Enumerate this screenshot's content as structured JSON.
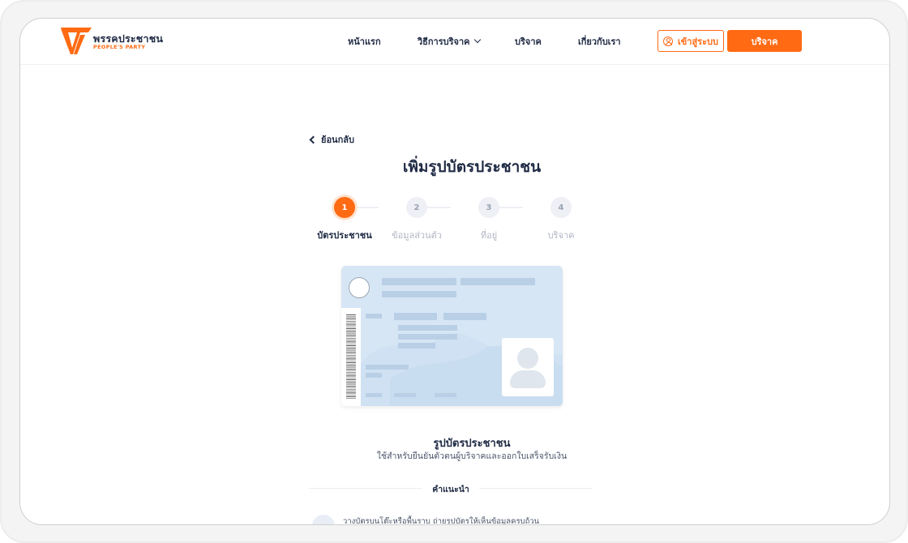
{
  "header": {
    "logo_th": "พรรคประชาชน",
    "logo_en": "PEOPLE'S PARTY",
    "nav": [
      {
        "label": "หน้าแรก"
      },
      {
        "label": "วิธีการบริจาค"
      },
      {
        "label": "บริจาค"
      },
      {
        "label": "เกี่ยวกับเรา"
      }
    ],
    "login_label": "เข้าสู่ระบบ",
    "donate_label": "บริจาค"
  },
  "content": {
    "back_label": "ย้อนกลับ",
    "title": "เพิ่มรูปบัตรประชาชน",
    "steps": [
      {
        "number": "1",
        "label": "บัตรประชาชน",
        "active": true
      },
      {
        "number": "2",
        "label": "ข้อมูลส่วนตัว",
        "active": false
      },
      {
        "number": "3",
        "label": "ที่อยู่",
        "active": false
      },
      {
        "number": "4",
        "label": "บริจาค",
        "active": false
      }
    ],
    "card_title": "รูปบัตรประชาชน",
    "card_subtitle": "ใช้สำหรับยืนยันตัวตนผู้บริจาคและออกใบเสร็จรับเงิน",
    "tips_heading": "คำแนะนำ",
    "tip_1": "วางบัตรบนโต๊ะหรือพื้นราบ ถ่ายรูปบัตรให้เห็นข้อมูลครบถ้วน"
  },
  "colors": {
    "accent": "#ff6a13",
    "text": "#1f2a44",
    "muted": "#b0b6c3",
    "card": "#d6e6f5"
  },
  "icons": [
    "logo-mark-icon",
    "chevron-down-icon",
    "user-icon",
    "chevron-left-icon",
    "id-card-illustration",
    "avatar-placeholder-icon",
    "tip-icon"
  ]
}
